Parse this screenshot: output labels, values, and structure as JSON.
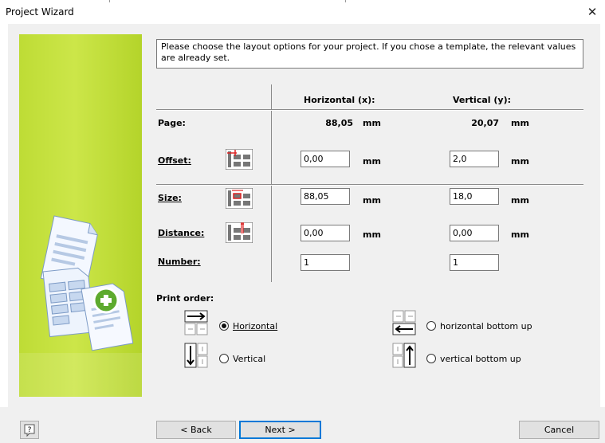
{
  "window": {
    "title": "Project Wizard",
    "close_glyph": "✕"
  },
  "description": "Please choose the layout options for your project. If you chose a template, the relevant values are already set.",
  "columns": {
    "horizontal": "Horizontal (x):",
    "vertical": "Vertical (y):"
  },
  "page": {
    "label": "Page:",
    "x": "88,05",
    "x_unit": "mm",
    "y": "20,07",
    "y_unit": "mm"
  },
  "offset": {
    "label": "Offset:",
    "icon": "offset-grid-icon",
    "x": "0,00",
    "x_unit": "mm",
    "y": "2,0",
    "y_unit": "mm"
  },
  "size": {
    "label": "Size:",
    "icon": "size-grid-icon",
    "x": "88,05",
    "x_unit": "mm",
    "y": "18,0",
    "y_unit": "mm"
  },
  "distance": {
    "label": "Distance:",
    "icon": "distance-grid-icon",
    "x": "0,00",
    "x_unit": "mm",
    "y": "0,00",
    "y_unit": "mm"
  },
  "number": {
    "label": "Number:",
    "x": "1",
    "y": "1"
  },
  "print_order": {
    "label": "Print order:",
    "options": [
      {
        "label": "Horizontal",
        "selected": true,
        "icon": "horizontal-order-icon"
      },
      {
        "label": "horizontal bottom up",
        "selected": false,
        "icon": "horizontal-bottom-up-icon"
      },
      {
        "label": "Vertical",
        "selected": false,
        "icon": "vertical-order-icon"
      },
      {
        "label": "vertical bottom up",
        "selected": false,
        "icon": "vertical-bottom-up-icon"
      }
    ]
  },
  "buttons": {
    "help": "?",
    "back": "< Back",
    "next": "Next >",
    "cancel": "Cancel"
  },
  "colors": {
    "accent": "#0078d7",
    "panel_green": "#c4e03c"
  }
}
